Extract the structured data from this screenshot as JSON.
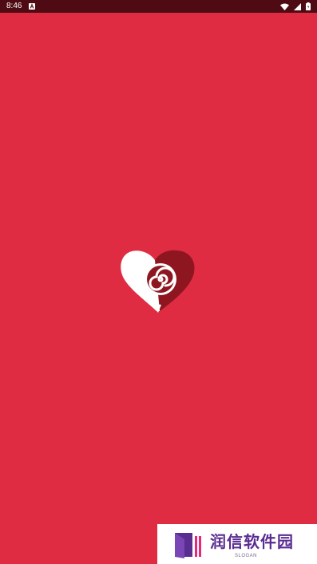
{
  "status_bar": {
    "time": "8:46",
    "icons": [
      "notification-a-icon",
      "wifi-icon",
      "signal-icon",
      "battery-icon"
    ]
  },
  "splash": {
    "background_color": "#df2c42",
    "logo": "heart-swirl-logo"
  },
  "watermark": {
    "name": "润信软件园",
    "slogan": "SLOGAN",
    "brand_color": "#5a2d91",
    "accent_color": "#e8267a"
  }
}
